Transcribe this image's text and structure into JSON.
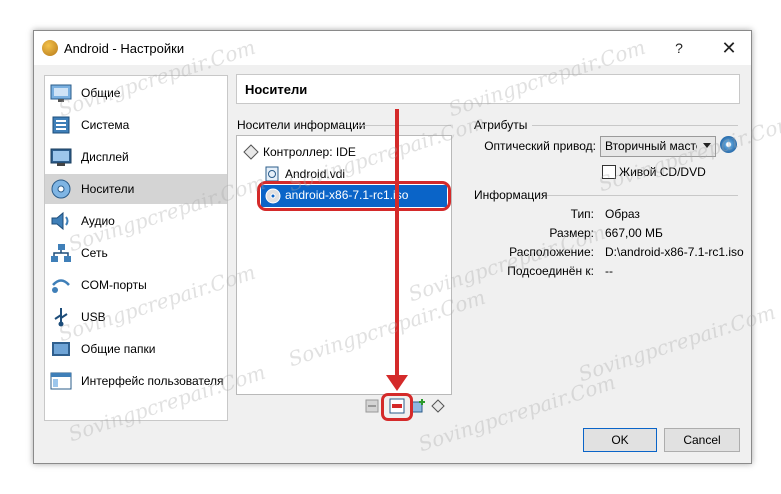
{
  "window": {
    "title": "Android - Настройки",
    "help_label": "?",
    "close_label": "✕"
  },
  "sidebar": {
    "items": [
      {
        "label": "Общие",
        "icon": "general-icon"
      },
      {
        "label": "Система",
        "icon": "system-icon"
      },
      {
        "label": "Дисплей",
        "icon": "display-icon"
      },
      {
        "label": "Носители",
        "icon": "storage-icon",
        "selected": true
      },
      {
        "label": "Аудио",
        "icon": "audio-icon"
      },
      {
        "label": "Сеть",
        "icon": "network-icon"
      },
      {
        "label": "COM-порты",
        "icon": "serial-ports-icon"
      },
      {
        "label": "USB",
        "icon": "usb-icon"
      },
      {
        "label": "Общие папки",
        "icon": "shared-folders-icon"
      },
      {
        "label": "Интерфейс пользователя",
        "icon": "user-interface-icon"
      }
    ]
  },
  "header": {
    "title": "Носители"
  },
  "storage": {
    "group_label": "Носители информации",
    "controller": "Контроллер: IDE",
    "devices": [
      {
        "label": "Android.vdi",
        "icon": "hard-disk-icon"
      },
      {
        "label": "android-x86-7.1-rc1.iso",
        "icon": "optical-disc-icon",
        "selected": true
      }
    ]
  },
  "attributes": {
    "group_label": "Атрибуты",
    "optical_drive_label": "Оптический привод:",
    "optical_drive_value": "Вторичный мастер",
    "live_cd_label": "Живой CD/DVD",
    "live_cd_checked": false
  },
  "information": {
    "group_label": "Информация",
    "rows": [
      {
        "label": "Тип:",
        "value": "Образ"
      },
      {
        "label": "Размер:",
        "value": "667,00 МБ"
      },
      {
        "label": "Расположение:",
        "value": "D:\\android-x86-7.1-rc1.iso"
      },
      {
        "label": "Подсоединён к:",
        "value": "--"
      }
    ]
  },
  "buttons": {
    "ok": "OK",
    "cancel": "Cancel"
  },
  "watermark": "Sovingpcrepair.Com",
  "colors": {
    "selection": "#0a64c8",
    "highlight": "#d42a2a"
  }
}
